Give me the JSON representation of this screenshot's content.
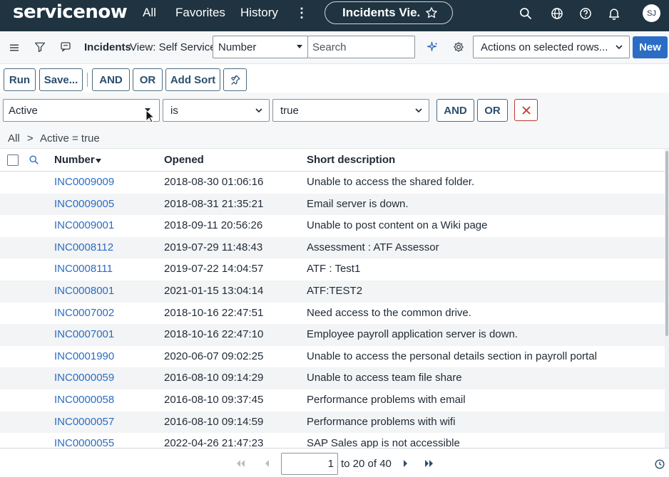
{
  "topnav": {
    "logo": "servicenow",
    "all": "All",
    "favorites": "Favorites",
    "history": "History",
    "more": "⋮",
    "pill_label": "Incidents Vie...",
    "avatar_initials": "SJ"
  },
  "listbar": {
    "title": "Incidents",
    "view": "View: Self Service",
    "field_select": "Number",
    "search_placeholder": "Search",
    "actions_select": "Actions on selected rows...",
    "new_button": "New"
  },
  "toolbar": {
    "run": "Run",
    "save": "Save...",
    "and": "AND",
    "or": "OR",
    "add_sort": "Add Sort"
  },
  "condition": {
    "field": "Active",
    "operator": "is",
    "value": "true",
    "and": "AND",
    "or": "OR"
  },
  "breadcrumb": {
    "all": "All",
    "separator": ">",
    "filter": "Active = true"
  },
  "table": {
    "headers": {
      "number": "Number",
      "opened": "Opened",
      "short_description": "Short description"
    },
    "rows": [
      {
        "number": "INC0009009",
        "opened": "2018-08-30 01:06:16",
        "desc": "Unable to access the shared folder."
      },
      {
        "number": "INC0009005",
        "opened": "2018-08-31 21:35:21",
        "desc": "Email server is down."
      },
      {
        "number": "INC0009001",
        "opened": "2018-09-11 20:56:26",
        "desc": "Unable to post content on a Wiki page"
      },
      {
        "number": "INC0008112",
        "opened": "2019-07-29 11:48:43",
        "desc": "Assessment : ATF Assessor"
      },
      {
        "number": "INC0008111",
        "opened": "2019-07-22 14:04:57",
        "desc": "ATF : Test1"
      },
      {
        "number": "INC0008001",
        "opened": "2021-01-15 13:04:14",
        "desc": "ATF:TEST2"
      },
      {
        "number": "INC0007002",
        "opened": "2018-10-16 22:47:51",
        "desc": "Need access to the common drive."
      },
      {
        "number": "INC0007001",
        "opened": "2018-10-16 22:47:10",
        "desc": "Employee payroll application server is down."
      },
      {
        "number": "INC0001990",
        "opened": "2020-06-07 09:02:25",
        "desc": "Unable to access the personal details section in payroll portal"
      },
      {
        "number": "INC0000059",
        "opened": "2016-08-10 09:14:29",
        "desc": "Unable to access team file share"
      },
      {
        "number": "INC0000058",
        "opened": "2016-08-10 09:37:45",
        "desc": "Performance problems with email"
      },
      {
        "number": "INC0000057",
        "opened": "2016-08-10 09:14:59",
        "desc": "Performance problems with wifi"
      },
      {
        "number": "INC0000055",
        "opened": "2022-04-26 21:47:23",
        "desc": "SAP Sales app is not accessible"
      }
    ]
  },
  "pager": {
    "current": "1",
    "range_text": "to 20 of 40"
  },
  "colors": {
    "nav_bg": "#1f3340",
    "link": "#2b6cc4",
    "accent_button": "#2b6cc4",
    "remove_red": "#c0392b"
  }
}
